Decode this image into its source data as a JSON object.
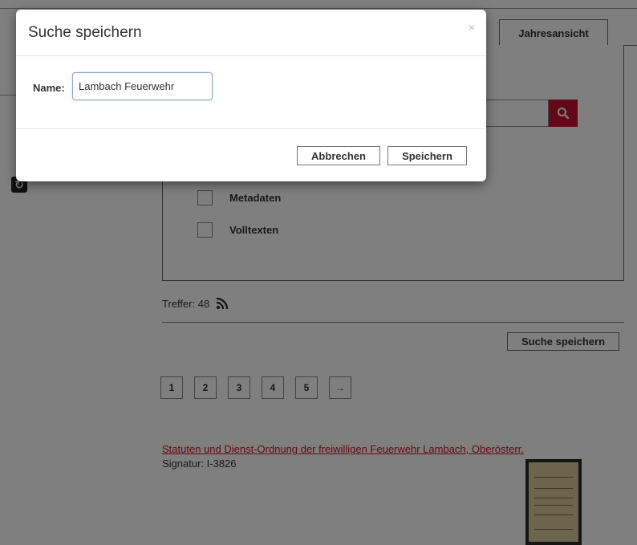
{
  "page": {
    "tab_year_label": "Jahresansicht",
    "search_in": {
      "options": [
        {
          "label": "Metadaten",
          "checked": false
        },
        {
          "label": "Volltexten",
          "checked": false
        }
      ]
    },
    "hits_label": "Treffer: 48",
    "save_search_label": "Suche speichern",
    "pagination": [
      "1",
      "2",
      "3",
      "4",
      "5",
      "→"
    ],
    "result": {
      "title": "Statuten und Dienst-Ordnung der freiwilligen Feuerwehr Lambach, Oberösterr.",
      "signature": "Signatur: I-3826"
    },
    "icons": [
      "search-icon",
      "rss-icon",
      "logo-icon"
    ],
    "colors": {
      "accent": "#c8102e",
      "overlay": "rgba(0,0,0,0.5)"
    }
  },
  "modal": {
    "title": "Suche speichern",
    "close_label": "×",
    "name_label": "Name:",
    "name_value": "Lambach Feuerwehr",
    "cancel_label": "Abbrechen",
    "save_label": "Speichern"
  }
}
